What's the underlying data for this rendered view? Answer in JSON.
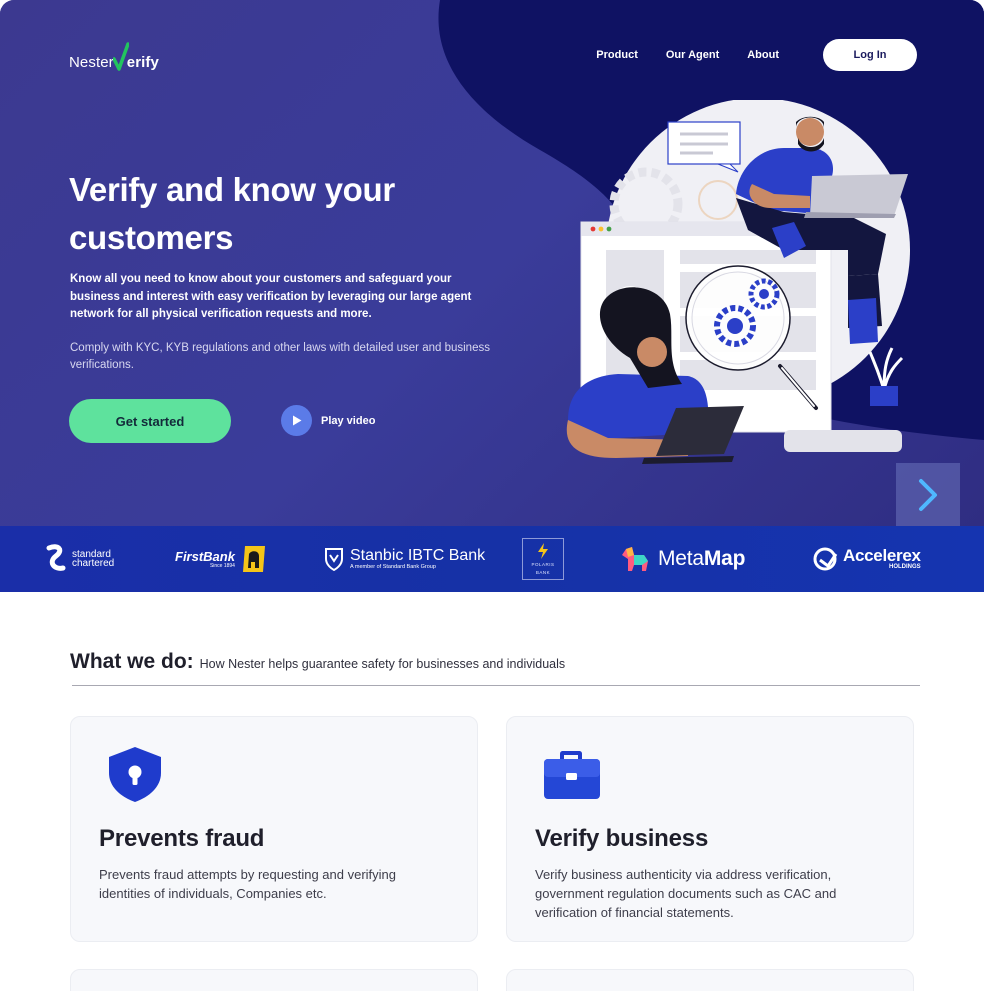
{
  "brand": {
    "logo_text_part1": "Nester",
    "logo_text_part2": "erify",
    "logo_check_color": "#22c55e"
  },
  "nav": {
    "items": [
      "Product",
      "Our Agent",
      "About"
    ],
    "login_label": "Log In"
  },
  "hero": {
    "headline": "Verify and know your customers",
    "lead": "Know all you need to know about your customers and safeguard your business and interest with easy verification by leveraging our large agent network for all physical verification requests and more.",
    "sub": "Comply with KYC, KYB regulations and other laws with detailed user and business verifications.",
    "cta_label": "Get started",
    "play_label": "Play video",
    "colors": {
      "background": "#3b3b8f",
      "accent_blob": "#0f1263",
      "cta": "#5ee29d"
    }
  },
  "partners": [
    {
      "name": "standard chartered",
      "line1": "standard",
      "line2": "chartered"
    },
    {
      "name": "FirstBank",
      "line1": "FirstBank",
      "line2": "Since 1894"
    },
    {
      "name": "Stanbic IBTC Bank",
      "line1": "Stanbic IBTC Bank",
      "line2": "A member of Standard Bank Group"
    },
    {
      "name": "Polaris Bank",
      "line1": "POLARIS",
      "line2": "BANK"
    },
    {
      "name": "MetaMap",
      "line1": "Meta",
      "line2": "Map"
    },
    {
      "name": "Accelerex Holdings",
      "line1": "Accelerex",
      "line2": "HOLDINGS"
    }
  ],
  "what_we_do": {
    "title": "What we do:",
    "subtitle": "How Nester helps guarantee safety for businesses and individuals",
    "cards": [
      {
        "title": "Prevents fraud",
        "desc": "Prevents fraud attempts by requesting and verifying identities of individuals, Companies etc.",
        "icon": "shield-lock-icon"
      },
      {
        "title": "Verify business",
        "desc": "Verify business authenticity via address verification, government regulation documents such as CAC and verification of financial statements.",
        "icon": "briefcase-icon"
      }
    ]
  }
}
